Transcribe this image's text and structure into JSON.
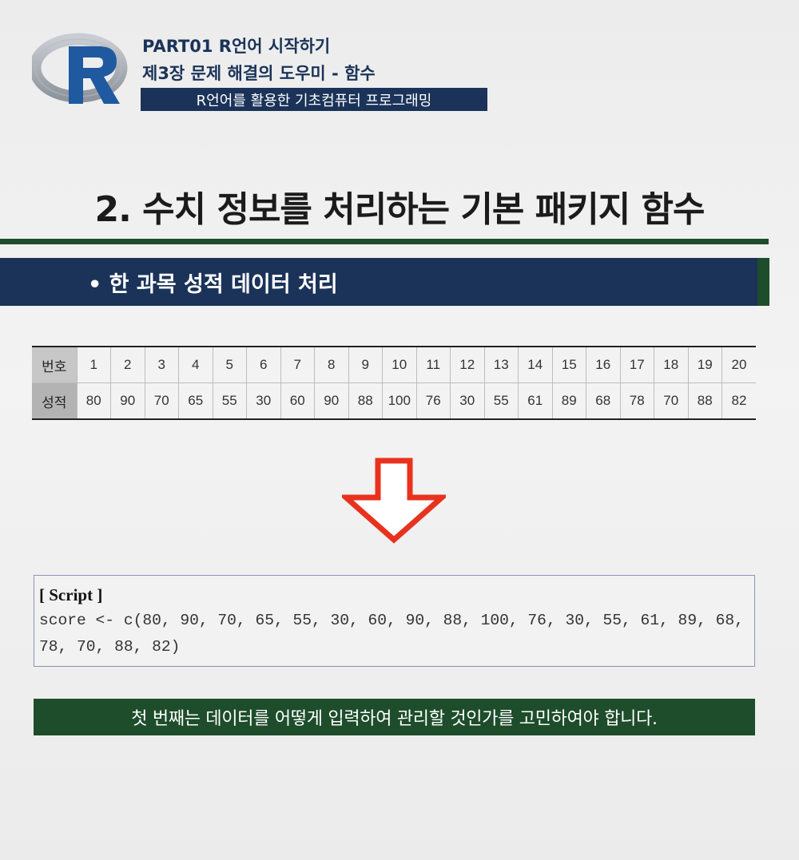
{
  "header": {
    "part": "PART01 R언어 시작하기",
    "chapter": "제3장 문제 해결의 도우미 - 함수",
    "book": "R언어를 활용한 기초컴퓨터 프로그래밍"
  },
  "heading": "2. 수치 정보를 처리하는 기본 패키지 함수",
  "section": "• 한 과목 성적 데이터 처리",
  "table": {
    "row_headers": [
      "번호",
      "성적"
    ],
    "numbers": [
      "1",
      "2",
      "3",
      "4",
      "5",
      "6",
      "7",
      "8",
      "9",
      "10",
      "11",
      "12",
      "13",
      "14",
      "15",
      "16",
      "17",
      "18",
      "19",
      "20"
    ],
    "scores": [
      "80",
      "90",
      "70",
      "65",
      "55",
      "30",
      "60",
      "90",
      "88",
      "100",
      "76",
      "30",
      "55",
      "61",
      "89",
      "68",
      "78",
      "70",
      "88",
      "82"
    ]
  },
  "arrow_icon": "down-arrow-icon",
  "script": {
    "label": "[ Script ]",
    "code": "score <- c(80, 90, 70, 65, 55, 30, 60, 90, 88, 100, 76, 30, 55, 61, 89, 68, 78, 70, 88, 82)"
  },
  "caption": "첫 번째는 데이터를 어떻게 입력하여 관리할 것인가를 고민하여야 합니다.",
  "colors": {
    "navy": "#1b3359",
    "green": "#1e4d2b",
    "arrow_red": "#e8321e",
    "r_logo_blue": "#1f5aa0"
  }
}
